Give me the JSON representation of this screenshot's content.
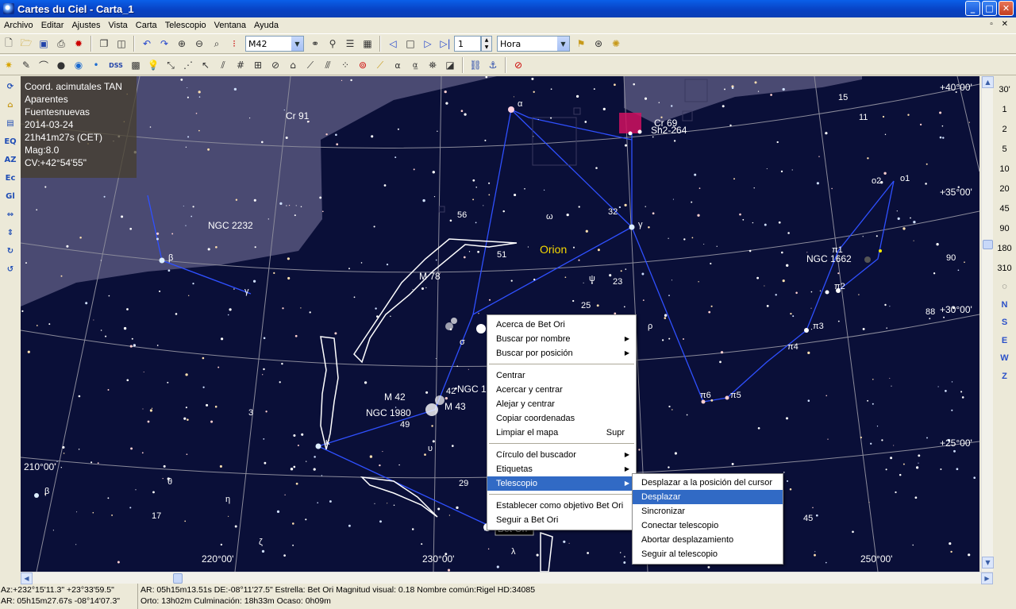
{
  "window": {
    "title": "Cartes du Ciel - Carta_1"
  },
  "menubar": [
    "Archivo",
    "Editar",
    "Ajustes",
    "Vista",
    "Carta",
    "Telescopio",
    "Ventana",
    "Ayuda"
  ],
  "toolbar": {
    "object_search": "M42",
    "step": "1",
    "time_unit": "Hora"
  },
  "toolbar2": {
    "dss_label": "DSS"
  },
  "left_toolbar": [
    "EQ",
    "AZ",
    "Ec",
    "Gl"
  ],
  "right_toolbar": {
    "fov": [
      "30'",
      "1",
      "2",
      "5",
      "10",
      "20",
      "45",
      "90",
      "180",
      "310"
    ],
    "directions": [
      "N",
      "S",
      "E",
      "W",
      "Z"
    ]
  },
  "info_panel": {
    "lines": [
      "Coord. acimutales TAN",
      "Aparentes",
      "Fuentesnuevas",
      "2014-03-24",
      "21h41m27s (CET)",
      "Mag:8.0",
      "CV:+42°54'55\""
    ]
  },
  "chart": {
    "grid_labels": [
      "+40°00'",
      "+35°00'",
      "+30°00'",
      "+25°00'",
      "210°00'",
      "220°00'",
      "230°00'",
      "250°00'"
    ],
    "constellation": "Orion",
    "objects": [
      "Cr 91",
      "NGC 2232",
      "Cr 69",
      "Sh2-264",
      "M 78",
      "NGC 1662",
      "M 42",
      "NGC 1980",
      "M 43",
      "NGC 1",
      "Bet Ori"
    ],
    "star_labels": [
      "α",
      "β",
      "γ",
      "ω",
      "ψ",
      "ρ",
      "σ",
      "κ",
      "υ",
      "θ",
      "η",
      "ζ",
      "λ",
      "β",
      "γ",
      "15",
      "11",
      "o2",
      "o1",
      "π1",
      "π2",
      "π3",
      "π4",
      "π5",
      "π6",
      "56",
      "32",
      "51",
      "23",
      "25",
      "29",
      "3",
      "17",
      "49",
      "42",
      "90",
      "88",
      "45"
    ]
  },
  "context_menu": {
    "items": [
      {
        "label": "Acerca de Bet Ori"
      },
      {
        "label": "Buscar por nombre",
        "submenu": true
      },
      {
        "label": "Buscar por posición",
        "submenu": true
      },
      {
        "sep": true
      },
      {
        "label": "Centrar"
      },
      {
        "label": "Acercar y centrar"
      },
      {
        "label": "Alejar y centrar"
      },
      {
        "label": "Copiar coordenadas"
      },
      {
        "label": "Limpiar el mapa",
        "shortcut": "Supr"
      },
      {
        "sep": true
      },
      {
        "label": "Círculo del buscador",
        "submenu": true
      },
      {
        "label": "Etiquetas",
        "submenu": true
      },
      {
        "label": "Telescopio",
        "submenu": true,
        "highlighted": true
      },
      {
        "sep": true
      },
      {
        "label": "Establecer como objetivo Bet Ori"
      },
      {
        "label": "Seguir a Bet Ori"
      }
    ]
  },
  "telescope_submenu": {
    "items": [
      {
        "label": "Desplazar a la posición del cursor"
      },
      {
        "label": "Desplazar",
        "highlighted": true
      },
      {
        "label": "Sincronizar"
      },
      {
        "label": "Conectar telescopio"
      },
      {
        "label": "Abortar desplazamiento"
      },
      {
        "label": "Seguir al telescopio"
      }
    ]
  },
  "statusbar": {
    "az": "Az:+232°15'11.3\" +23°33'59.5\"",
    "ar": "AR: 05h15m27.67s -08°14'07.3\"",
    "object_line": "AR: 05h15m13.51s DE:-08°11'27.5\"  Estrella: Bet Ori  Magnitud visual:  0.18  Nombre común:Rigel  HD:34085",
    "times_line": "Orto: 13h02m   Culminación: 18h33m   Ocaso:  0h09m"
  },
  "colors": {
    "sky": "#0a0f38",
    "title_bar": "#0842C4",
    "menu_highlight": "#316AC5",
    "constellation_label": "#f5d800"
  }
}
